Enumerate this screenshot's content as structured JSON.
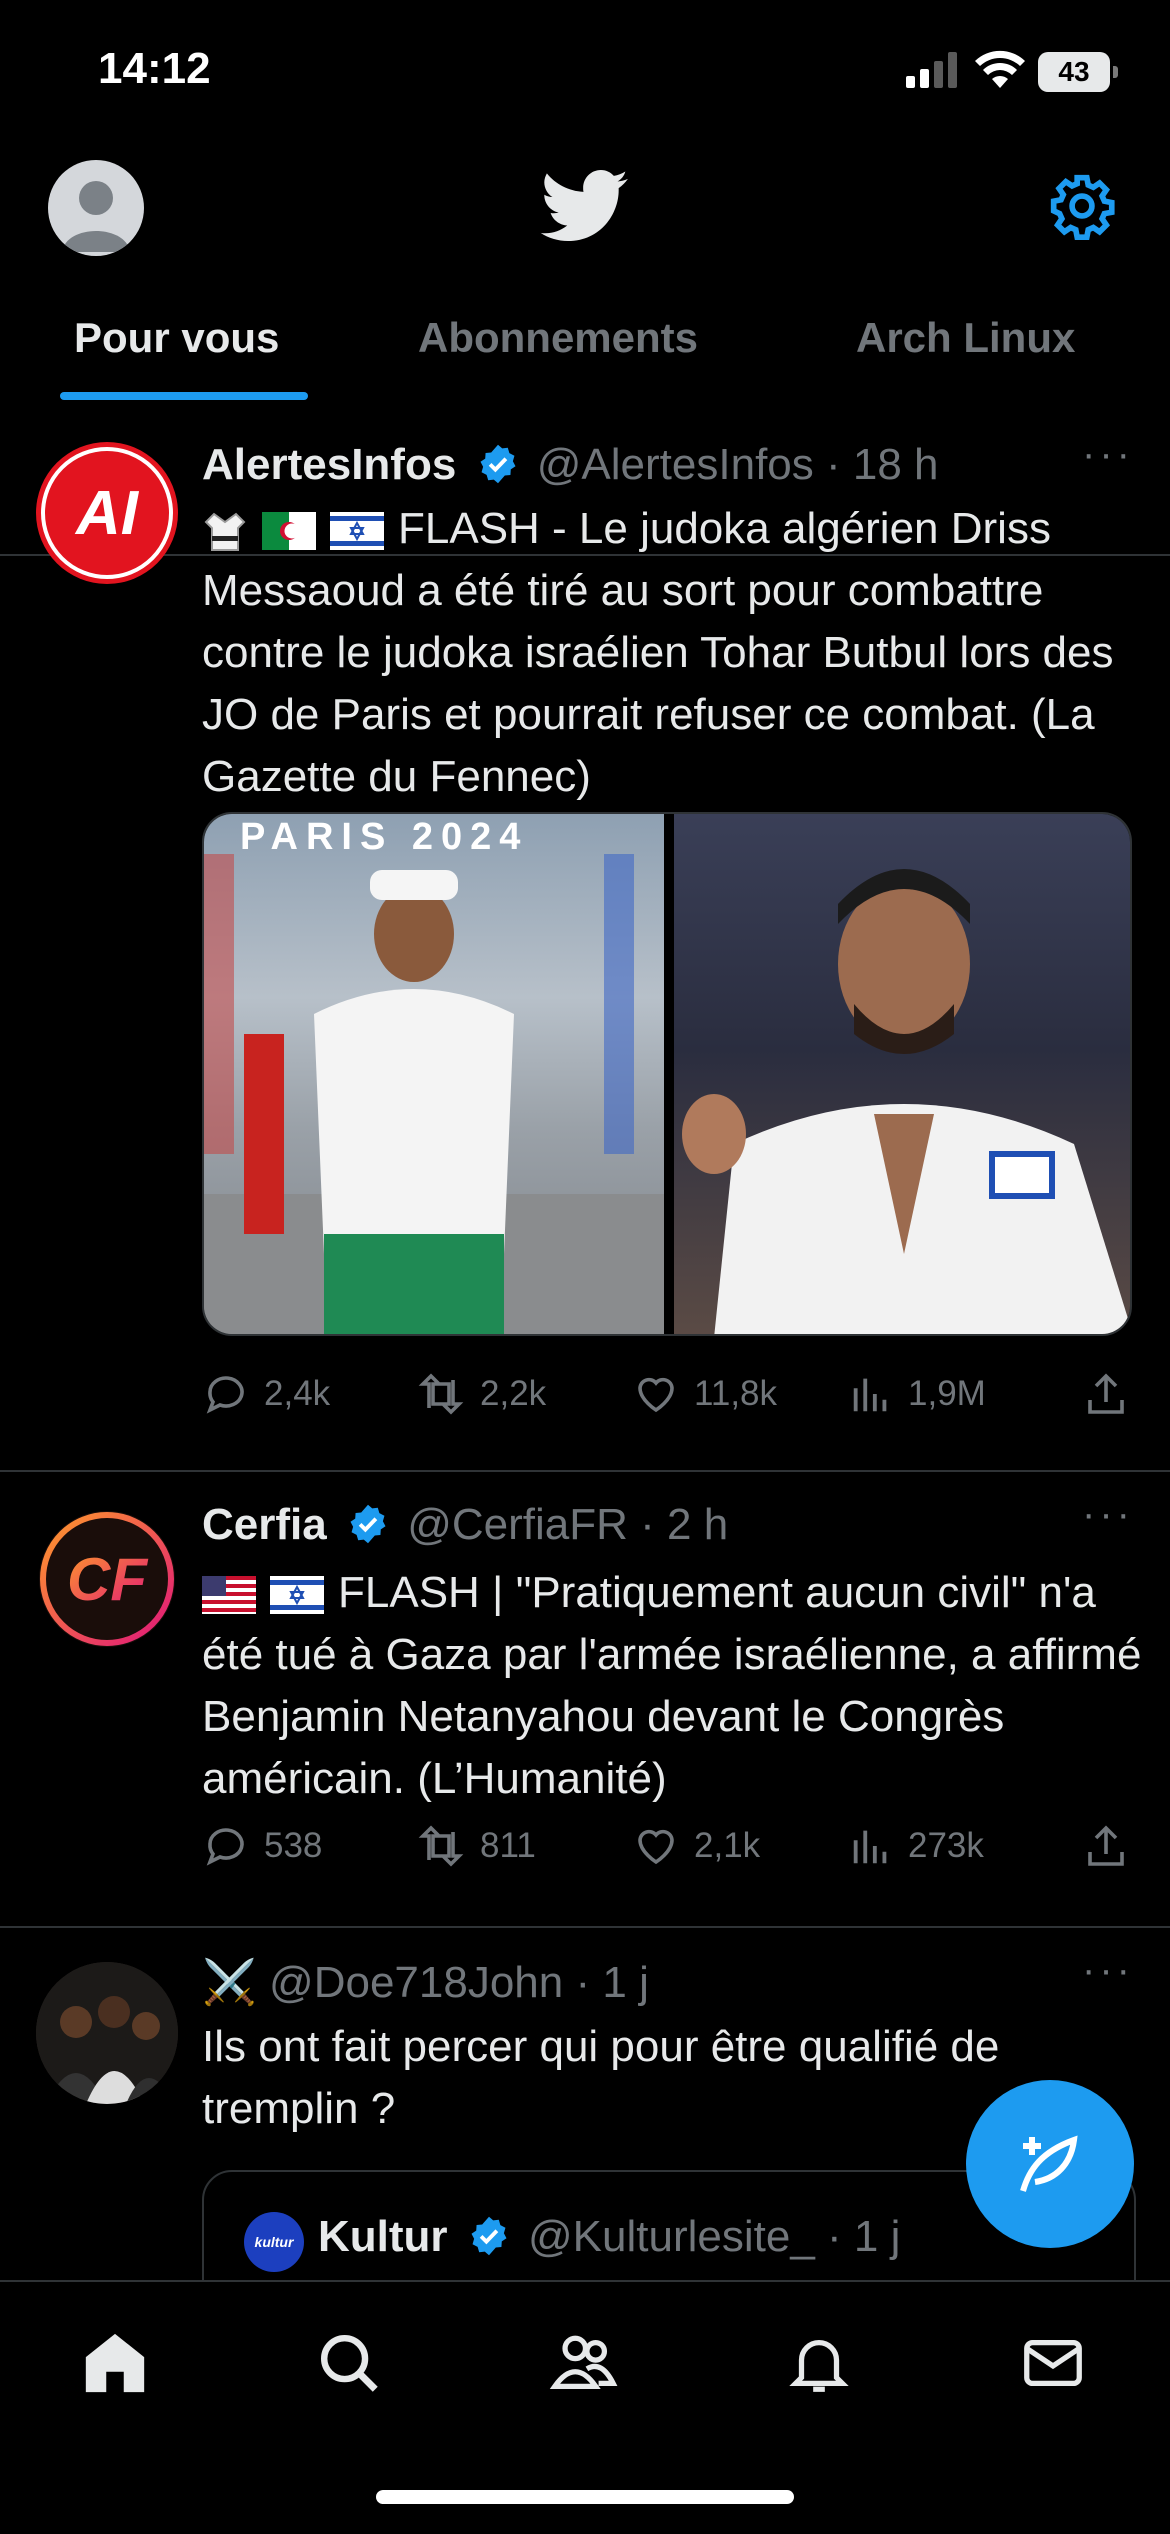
{
  "status": {
    "time": "14:12",
    "battery": "43"
  },
  "tabs": [
    {
      "label": "Pour vous",
      "active": true
    },
    {
      "label": "Abonnements",
      "active": false
    },
    {
      "label": "Arch Linux",
      "active": false
    }
  ],
  "colors": {
    "accent": "#1d9bf0",
    "background": "#000000",
    "muted": "#71767b",
    "text": "#e7e9ea"
  },
  "tweets": [
    {
      "name": "AlertesInfos",
      "handle": "@AlertesInfos",
      "dot": "·",
      "time": "18 h",
      "avatar_text": "AI",
      "emojis": [
        "judo-emoji",
        "algeria-flag",
        "israel-flag"
      ],
      "text": "FLASH - Le judoka algérien Driss Messaoud a été tiré au sort pour combattre contre le judoka israélien Tohar Butbul lors des JO de Paris et pourrait refuser ce combat. (La Gazette du Fennec)",
      "media_caption": "PARIS 2024",
      "replies": "2,4k",
      "reposts": "2,2k",
      "likes": "11,8k",
      "views": "1,9M"
    },
    {
      "name": "Cerfia",
      "handle": "@CerfiaFR",
      "dot": "·",
      "time": "2 h",
      "avatar_text": "CF",
      "emojis": [
        "usa-flag",
        "israel-flag"
      ],
      "text": "FLASH | \"Pratiquement aucun civil\" n'a été tué à Gaza par l'armée israélienne, a affirmé Benjamin Netanyahou devant le Congrès américain. (L’Humanité)",
      "replies": "538",
      "reposts": "811",
      "likes": "2,1k",
      "views": "273k"
    },
    {
      "name": "⚔️",
      "handle": "@Doe718John",
      "dot": "·",
      "time": "1 j",
      "text": "Ils ont fait percer qui pour être qualifié de tremplin ?",
      "quote": {
        "name": "Kultur",
        "handle": "@Kulturlesite_",
        "dot": "·",
        "time": "1 j",
        "avatar_text": "kultur"
      }
    }
  ],
  "more_label": "···"
}
